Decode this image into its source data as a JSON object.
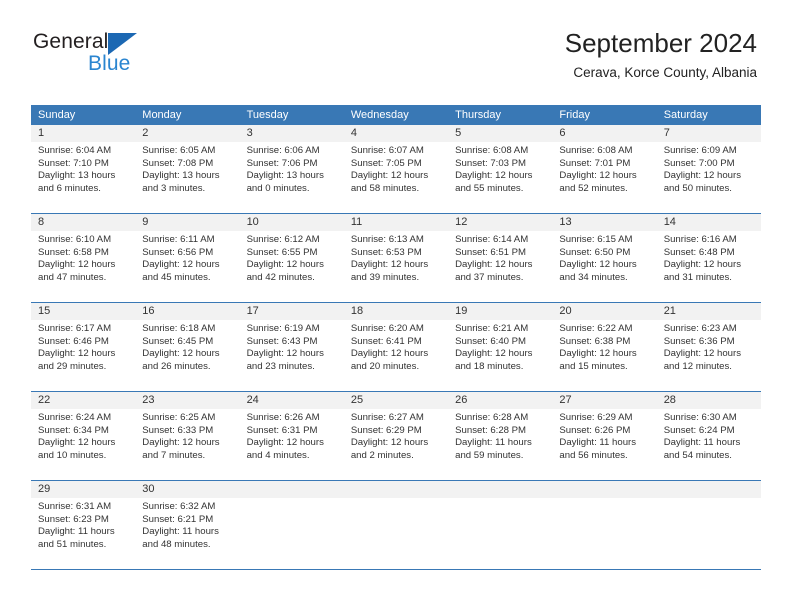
{
  "brand": {
    "word_one": "General",
    "word_two": "Blue",
    "triangle_color": "#1c68b3",
    "blue_text_color": "#2a85d0"
  },
  "header": {
    "title": "September 2024",
    "subtitle": "Cerava, Korce County, Albania"
  },
  "calendar": {
    "header_bg": "#3978b5",
    "number_band_bg": "#f2f2f2",
    "day_names": [
      "Sunday",
      "Monday",
      "Tuesday",
      "Wednesday",
      "Thursday",
      "Friday",
      "Saturday"
    ],
    "weeks": [
      {
        "days": [
          {
            "date": "1",
            "sunrise": "Sunrise: 6:04 AM",
            "sunset": "Sunset: 7:10 PM",
            "daylight_1": "Daylight: 13 hours",
            "daylight_2": "and 6 minutes."
          },
          {
            "date": "2",
            "sunrise": "Sunrise: 6:05 AM",
            "sunset": "Sunset: 7:08 PM",
            "daylight_1": "Daylight: 13 hours",
            "daylight_2": "and 3 minutes."
          },
          {
            "date": "3",
            "sunrise": "Sunrise: 6:06 AM",
            "sunset": "Sunset: 7:06 PM",
            "daylight_1": "Daylight: 13 hours",
            "daylight_2": "and 0 minutes."
          },
          {
            "date": "4",
            "sunrise": "Sunrise: 6:07 AM",
            "sunset": "Sunset: 7:05 PM",
            "daylight_1": "Daylight: 12 hours",
            "daylight_2": "and 58 minutes."
          },
          {
            "date": "5",
            "sunrise": "Sunrise: 6:08 AM",
            "sunset": "Sunset: 7:03 PM",
            "daylight_1": "Daylight: 12 hours",
            "daylight_2": "and 55 minutes."
          },
          {
            "date": "6",
            "sunrise": "Sunrise: 6:08 AM",
            "sunset": "Sunset: 7:01 PM",
            "daylight_1": "Daylight: 12 hours",
            "daylight_2": "and 52 minutes."
          },
          {
            "date": "7",
            "sunrise": "Sunrise: 6:09 AM",
            "sunset": "Sunset: 7:00 PM",
            "daylight_1": "Daylight: 12 hours",
            "daylight_2": "and 50 minutes."
          }
        ]
      },
      {
        "days": [
          {
            "date": "8",
            "sunrise": "Sunrise: 6:10 AM",
            "sunset": "Sunset: 6:58 PM",
            "daylight_1": "Daylight: 12 hours",
            "daylight_2": "and 47 minutes."
          },
          {
            "date": "9",
            "sunrise": "Sunrise: 6:11 AM",
            "sunset": "Sunset: 6:56 PM",
            "daylight_1": "Daylight: 12 hours",
            "daylight_2": "and 45 minutes."
          },
          {
            "date": "10",
            "sunrise": "Sunrise: 6:12 AM",
            "sunset": "Sunset: 6:55 PM",
            "daylight_1": "Daylight: 12 hours",
            "daylight_2": "and 42 minutes."
          },
          {
            "date": "11",
            "sunrise": "Sunrise: 6:13 AM",
            "sunset": "Sunset: 6:53 PM",
            "daylight_1": "Daylight: 12 hours",
            "daylight_2": "and 39 minutes."
          },
          {
            "date": "12",
            "sunrise": "Sunrise: 6:14 AM",
            "sunset": "Sunset: 6:51 PM",
            "daylight_1": "Daylight: 12 hours",
            "daylight_2": "and 37 minutes."
          },
          {
            "date": "13",
            "sunrise": "Sunrise: 6:15 AM",
            "sunset": "Sunset: 6:50 PM",
            "daylight_1": "Daylight: 12 hours",
            "daylight_2": "and 34 minutes."
          },
          {
            "date": "14",
            "sunrise": "Sunrise: 6:16 AM",
            "sunset": "Sunset: 6:48 PM",
            "daylight_1": "Daylight: 12 hours",
            "daylight_2": "and 31 minutes."
          }
        ]
      },
      {
        "days": [
          {
            "date": "15",
            "sunrise": "Sunrise: 6:17 AM",
            "sunset": "Sunset: 6:46 PM",
            "daylight_1": "Daylight: 12 hours",
            "daylight_2": "and 29 minutes."
          },
          {
            "date": "16",
            "sunrise": "Sunrise: 6:18 AM",
            "sunset": "Sunset: 6:45 PM",
            "daylight_1": "Daylight: 12 hours",
            "daylight_2": "and 26 minutes."
          },
          {
            "date": "17",
            "sunrise": "Sunrise: 6:19 AM",
            "sunset": "Sunset: 6:43 PM",
            "daylight_1": "Daylight: 12 hours",
            "daylight_2": "and 23 minutes."
          },
          {
            "date": "18",
            "sunrise": "Sunrise: 6:20 AM",
            "sunset": "Sunset: 6:41 PM",
            "daylight_1": "Daylight: 12 hours",
            "daylight_2": "and 20 minutes."
          },
          {
            "date": "19",
            "sunrise": "Sunrise: 6:21 AM",
            "sunset": "Sunset: 6:40 PM",
            "daylight_1": "Daylight: 12 hours",
            "daylight_2": "and 18 minutes."
          },
          {
            "date": "20",
            "sunrise": "Sunrise: 6:22 AM",
            "sunset": "Sunset: 6:38 PM",
            "daylight_1": "Daylight: 12 hours",
            "daylight_2": "and 15 minutes."
          },
          {
            "date": "21",
            "sunrise": "Sunrise: 6:23 AM",
            "sunset": "Sunset: 6:36 PM",
            "daylight_1": "Daylight: 12 hours",
            "daylight_2": "and 12 minutes."
          }
        ]
      },
      {
        "days": [
          {
            "date": "22",
            "sunrise": "Sunrise: 6:24 AM",
            "sunset": "Sunset: 6:34 PM",
            "daylight_1": "Daylight: 12 hours",
            "daylight_2": "and 10 minutes."
          },
          {
            "date": "23",
            "sunrise": "Sunrise: 6:25 AM",
            "sunset": "Sunset: 6:33 PM",
            "daylight_1": "Daylight: 12 hours",
            "daylight_2": "and 7 minutes."
          },
          {
            "date": "24",
            "sunrise": "Sunrise: 6:26 AM",
            "sunset": "Sunset: 6:31 PM",
            "daylight_1": "Daylight: 12 hours",
            "daylight_2": "and 4 minutes."
          },
          {
            "date": "25",
            "sunrise": "Sunrise: 6:27 AM",
            "sunset": "Sunset: 6:29 PM",
            "daylight_1": "Daylight: 12 hours",
            "daylight_2": "and 2 minutes."
          },
          {
            "date": "26",
            "sunrise": "Sunrise: 6:28 AM",
            "sunset": "Sunset: 6:28 PM",
            "daylight_1": "Daylight: 11 hours",
            "daylight_2": "and 59 minutes."
          },
          {
            "date": "27",
            "sunrise": "Sunrise: 6:29 AM",
            "sunset": "Sunset: 6:26 PM",
            "daylight_1": "Daylight: 11 hours",
            "daylight_2": "and 56 minutes."
          },
          {
            "date": "28",
            "sunrise": "Sunrise: 6:30 AM",
            "sunset": "Sunset: 6:24 PM",
            "daylight_1": "Daylight: 11 hours",
            "daylight_2": "and 54 minutes."
          }
        ]
      },
      {
        "days": [
          {
            "date": "29",
            "sunrise": "Sunrise: 6:31 AM",
            "sunset": "Sunset: 6:23 PM",
            "daylight_1": "Daylight: 11 hours",
            "daylight_2": "and 51 minutes."
          },
          {
            "date": "30",
            "sunrise": "Sunrise: 6:32 AM",
            "sunset": "Sunset: 6:21 PM",
            "daylight_1": "Daylight: 11 hours",
            "daylight_2": "and 48 minutes."
          },
          {
            "date": "",
            "sunrise": "",
            "sunset": "",
            "daylight_1": "",
            "daylight_2": ""
          },
          {
            "date": "",
            "sunrise": "",
            "sunset": "",
            "daylight_1": "",
            "daylight_2": ""
          },
          {
            "date": "",
            "sunrise": "",
            "sunset": "",
            "daylight_1": "",
            "daylight_2": ""
          },
          {
            "date": "",
            "sunrise": "",
            "sunset": "",
            "daylight_1": "",
            "daylight_2": ""
          },
          {
            "date": "",
            "sunrise": "",
            "sunset": "",
            "daylight_1": "",
            "daylight_2": ""
          }
        ]
      }
    ]
  }
}
